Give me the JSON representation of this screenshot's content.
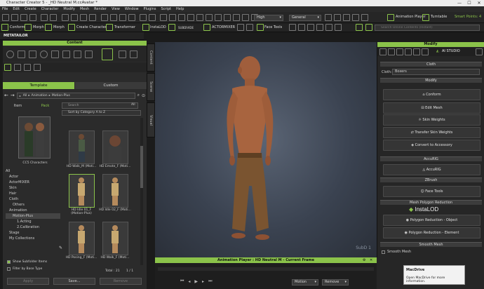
{
  "window": {
    "title": "Character Creator 5 - _HD Neutral M.ccAvatar *",
    "controls": [
      "—",
      "☐",
      "✕"
    ]
  },
  "menubar": [
    "File",
    "Edit",
    "Create",
    "Character",
    "Modify",
    "Mesh",
    "Render",
    "View",
    "Window",
    "Plugins",
    "Script",
    "Help"
  ],
  "toolbar1": {
    "quality": "High",
    "shading": "General",
    "animation_player": "Animation Player",
    "turntable": "Turntable",
    "smart_points": "Smart Points: 4"
  },
  "toolbar2": {
    "conform": "Conform",
    "morph": "Morph",
    "create_character": "Create Character",
    "transformer": "Transformer",
    "instalod": "InstaLOD",
    "subdivide": "SUBDIVIDE",
    "actormixer": "ACTORMIXER",
    "face_tools": "Face Tools",
    "search_placeholder": "Search Online Contents (Instant)"
  },
  "metatailor": "METATAILOR",
  "content": {
    "title": "Content",
    "tabs": [
      "Template",
      "Custom"
    ],
    "path": [
      "All",
      "Animation",
      "Motion-Plus"
    ],
    "search_placeholder": "Search",
    "all_label": "All",
    "sort": "Sort by Category A to Z",
    "left_tabs": [
      "Item",
      "Pack"
    ],
    "pack_name": "CC5 Characters",
    "tree": [
      "All",
      "Actor",
      "ActorMIXER",
      "Skin",
      "Hair",
      "Cloth",
      "Others",
      "Animation",
      "Motion-Plus",
      "1.Acting",
      "2.Calibration",
      "Stage",
      "My Collections"
    ],
    "items": [
      "HD Walk_M (Moti...",
      "HD Emote_F (Moti...",
      "HD Idle 01_F (Motion-Plus)",
      "HD Idle 02_F (Moti...",
      "HD Posing_F (Moti...",
      "HD Walk_F (Moti..."
    ],
    "total": "Total : 21",
    "page": "1 / 1",
    "show_subfolder": "Show Subfolder Items",
    "filter_base_type": "Filter by Base Type",
    "buttons": [
      "Apply",
      "Save...",
      "Remove"
    ],
    "side_tabs": [
      "Content",
      "Scene",
      "Visual"
    ]
  },
  "viewport": {
    "watermark": "SubD 1"
  },
  "modify": {
    "title": "Modify",
    "ai_studio": "AI STUDIO",
    "cloth_section": "Cloth",
    "cloth_label": "Cloth:",
    "cloth_value": "Boxers",
    "modify_section": "Modify",
    "modify_buttons": [
      "Conform",
      "Edit Mesh",
      "Skin Weights",
      "Transfer Skin Weights",
      "Convert to Accessory"
    ],
    "accurig_section": "AccuRIG",
    "accurig_button": "AccuRIG",
    "zbrush_section": "ZBrush",
    "face_tools_button": "Face Tools",
    "mesh_reduction_section": "Mesh Polygon Reduction",
    "instalod_logo": "InstaLOD",
    "reduction_buttons": [
      "Polygon Reduction - Object",
      "Polygon Reduction - Element"
    ],
    "smooth_section": "Smooth Mesh",
    "smooth_checkbox": "Smooth Mesh"
  },
  "animation_player": {
    "title": "Animation Player : HD Neutral M - Current Frame",
    "motion_select": "Motion",
    "remove": "Remove"
  },
  "tooltip": {
    "title": "MacDrive",
    "body": "Open MacDrive for more information."
  },
  "colors": {
    "accent": "#8bc34a",
    "panel": "#2b2b2b",
    "viewport": "#3a4250"
  }
}
